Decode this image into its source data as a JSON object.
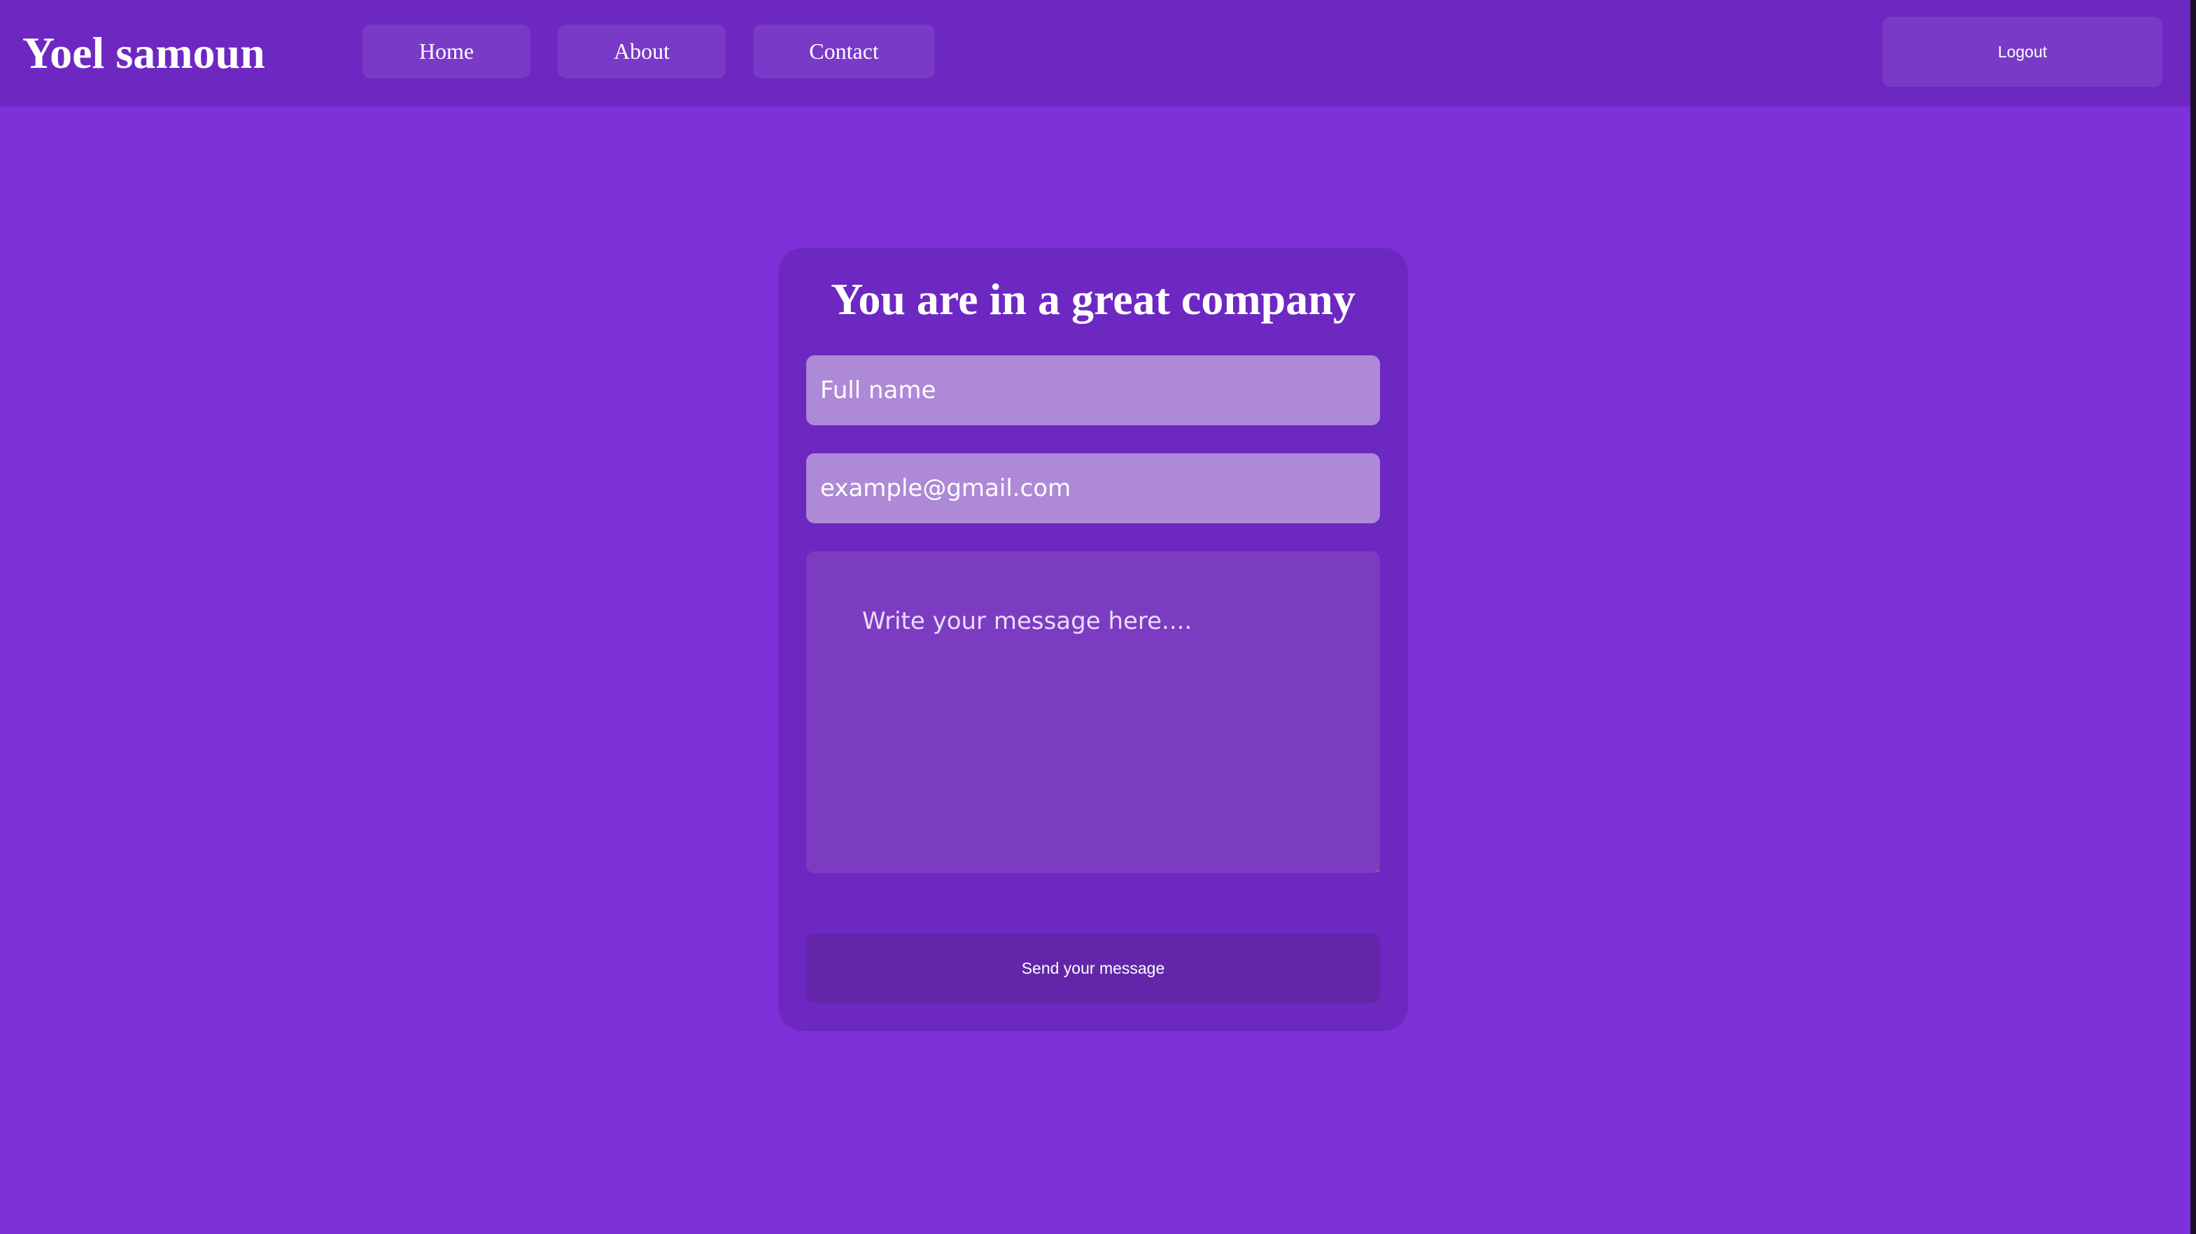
{
  "header": {
    "brand": "Yoel samoun",
    "nav": [
      {
        "label": "Home"
      },
      {
        "label": "About"
      },
      {
        "label": "Contact"
      }
    ],
    "logout_label": "Logout"
  },
  "form": {
    "title": "You are in a great company",
    "name_placeholder": "Full name",
    "email_placeholder": "example@gmail.com",
    "message_placeholder": "Write your message here....",
    "submit_label": "Send your message"
  },
  "colors": {
    "page_background": "#7e30d9",
    "header_background": "#6d28c2",
    "card_background": "#6d28c2",
    "input_background": "#ae89d8",
    "textarea_background": "#7c3cc1",
    "button_background": "#6326a9"
  }
}
